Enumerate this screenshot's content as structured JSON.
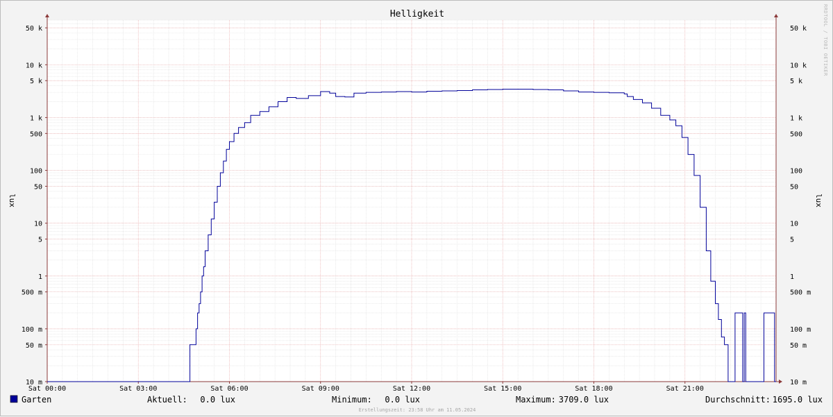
{
  "chart_data": {
    "type": "line",
    "title": "Helligkeit",
    "ylabel": "lux",
    "yscale": "log",
    "ylim": [
      0.01,
      70000
    ],
    "xlim": [
      "Sat 00:00",
      "Sat 24:00"
    ],
    "grid": true,
    "watermark": "RRDTOOL / TOBI OETIKER",
    "footer": "Erstellungszeit: 23:58 Uhr am 11.05.2024",
    "y_ticks": [
      {
        "v": 0.01,
        "label": "10 m"
      },
      {
        "v": 0.05,
        "label": "50 m"
      },
      {
        "v": 0.1,
        "label": "100 m"
      },
      {
        "v": 0.5,
        "label": "500 m"
      },
      {
        "v": 1,
        "label": "1"
      },
      {
        "v": 5,
        "label": "5"
      },
      {
        "v": 10,
        "label": "10"
      },
      {
        "v": 50,
        "label": "50"
      },
      {
        "v": 100,
        "label": "100"
      },
      {
        "v": 500,
        "label": "500"
      },
      {
        "v": 1000,
        "label": "1 k"
      },
      {
        "v": 5000,
        "label": "5 k"
      },
      {
        "v": 10000,
        "label": "10 k"
      },
      {
        "v": 50000,
        "label": "50 k"
      }
    ],
    "x_ticks": [
      {
        "h": 0,
        "label": "Sat 00:00"
      },
      {
        "h": 3,
        "label": "Sat 03:00"
      },
      {
        "h": 6,
        "label": "Sat 06:00"
      },
      {
        "h": 9,
        "label": "Sat 09:00"
      },
      {
        "h": 12,
        "label": "Sat 12:00"
      },
      {
        "h": 15,
        "label": "Sat 15:00"
      },
      {
        "h": 18,
        "label": "Sat 18:00"
      },
      {
        "h": 21,
        "label": "Sat 21:00"
      }
    ],
    "series": [
      {
        "name": "Garten",
        "color": "#000099",
        "step": true,
        "points": [
          [
            0,
            0.01
          ],
          [
            4.7,
            0.01
          ],
          [
            4.7,
            0.05
          ],
          [
            4.85,
            0.05
          ],
          [
            4.9,
            0.1
          ],
          [
            4.95,
            0.2
          ],
          [
            5.0,
            0.3
          ],
          [
            5.05,
            0.5
          ],
          [
            5.1,
            1
          ],
          [
            5.15,
            1.5
          ],
          [
            5.2,
            3
          ],
          [
            5.3,
            6
          ],
          [
            5.4,
            12
          ],
          [
            5.5,
            25
          ],
          [
            5.6,
            50
          ],
          [
            5.7,
            90
          ],
          [
            5.8,
            150
          ],
          [
            5.9,
            250
          ],
          [
            6.0,
            350
          ],
          [
            6.15,
            500
          ],
          [
            6.3,
            650
          ],
          [
            6.5,
            800
          ],
          [
            6.7,
            1100
          ],
          [
            7.0,
            1300
          ],
          [
            7.3,
            1600
          ],
          [
            7.6,
            2000
          ],
          [
            7.9,
            2400
          ],
          [
            8.2,
            2300
          ],
          [
            8.6,
            2600
          ],
          [
            9.0,
            3100
          ],
          [
            9.3,
            2900
          ],
          [
            9.5,
            2500
          ],
          [
            9.8,
            2450
          ],
          [
            10.1,
            2900
          ],
          [
            10.5,
            3000
          ],
          [
            11.0,
            3050
          ],
          [
            11.5,
            3100
          ],
          [
            12.0,
            3050
          ],
          [
            12.5,
            3150
          ],
          [
            13.0,
            3200
          ],
          [
            13.5,
            3250
          ],
          [
            14.0,
            3350
          ],
          [
            14.5,
            3400
          ],
          [
            15.0,
            3450
          ],
          [
            15.5,
            3450
          ],
          [
            16.0,
            3400
          ],
          [
            16.5,
            3350
          ],
          [
            17.0,
            3200
          ],
          [
            17.5,
            3050
          ],
          [
            18.0,
            3000
          ],
          [
            18.5,
            2950
          ],
          [
            19.0,
            2800
          ],
          [
            19.1,
            2500
          ],
          [
            19.3,
            2200
          ],
          [
            19.6,
            1900
          ],
          [
            19.9,
            1500
          ],
          [
            20.2,
            1100
          ],
          [
            20.5,
            900
          ],
          [
            20.7,
            700
          ],
          [
            20.9,
            420
          ],
          [
            21.1,
            200
          ],
          [
            21.3,
            80
          ],
          [
            21.5,
            20
          ],
          [
            21.7,
            3
          ],
          [
            21.85,
            0.8
          ],
          [
            22.0,
            0.3
          ],
          [
            22.1,
            0.15
          ],
          [
            22.2,
            0.07
          ],
          [
            22.3,
            0.05
          ],
          [
            22.42,
            0.01
          ],
          [
            22.65,
            0.01
          ],
          [
            22.65,
            0.2
          ],
          [
            22.9,
            0.2
          ],
          [
            22.9,
            0.01
          ],
          [
            22.95,
            0.01
          ],
          [
            22.95,
            0.2
          ],
          [
            23.0,
            0.2
          ],
          [
            23.0,
            0.01
          ],
          [
            23.6,
            0.01
          ],
          [
            23.6,
            0.2
          ],
          [
            23.95,
            0.2
          ],
          [
            23.95,
            0.01
          ],
          [
            24.0,
            0.01
          ]
        ]
      }
    ],
    "legend": {
      "swatch_color": "#000099",
      "name": "Garten",
      "stats": [
        {
          "label": "Aktuell:",
          "value": "0.0 lux"
        },
        {
          "label": "Minimum:",
          "value": "0.0 lux"
        },
        {
          "label": "Maximum:",
          "value": "3709.0 lux"
        },
        {
          "label": "Durchschnitt:",
          "value": "1695.0 lux"
        }
      ]
    }
  }
}
